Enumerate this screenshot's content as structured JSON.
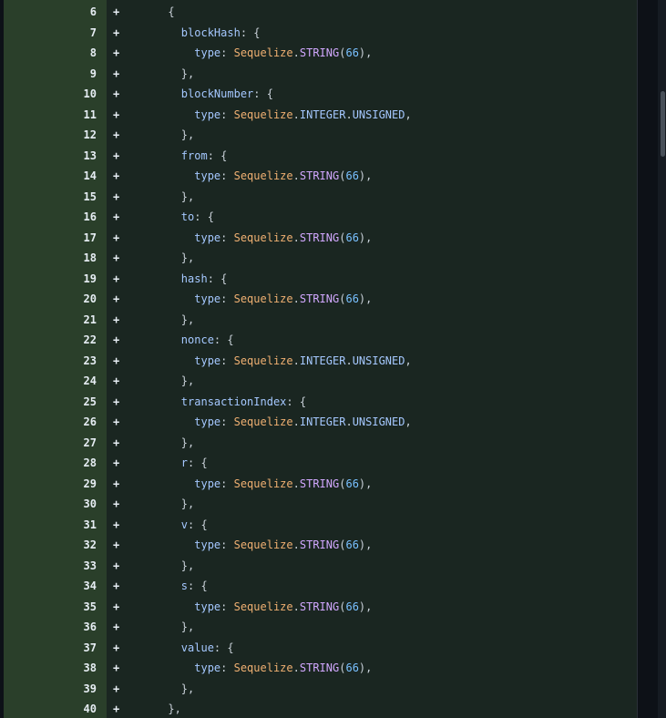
{
  "lines": [
    {
      "n": "6",
      "m": "+",
      "tokens": [
        {
          "t": "      {",
          "c": "punc"
        }
      ]
    },
    {
      "n": "7",
      "m": "+",
      "tokens": [
        {
          "t": "        blockHash",
          "c": "key"
        },
        {
          "t": ": {",
          "c": "punc"
        }
      ]
    },
    {
      "n": "8",
      "m": "+",
      "tokens": [
        {
          "t": "          type",
          "c": "key"
        },
        {
          "t": ": ",
          "c": "punc"
        },
        {
          "t": "Sequelize",
          "c": "class"
        },
        {
          "t": ".",
          "c": "punc"
        },
        {
          "t": "STRING",
          "c": "method"
        },
        {
          "t": "(",
          "c": "punc"
        },
        {
          "t": "66",
          "c": "num"
        },
        {
          "t": "),",
          "c": "punc"
        }
      ]
    },
    {
      "n": "9",
      "m": "+",
      "tokens": [
        {
          "t": "        },",
          "c": "punc"
        }
      ]
    },
    {
      "n": "10",
      "m": "+",
      "tokens": [
        {
          "t": "        blockNumber",
          "c": "key"
        },
        {
          "t": ": {",
          "c": "punc"
        }
      ]
    },
    {
      "n": "11",
      "m": "+",
      "tokens": [
        {
          "t": "          type",
          "c": "key"
        },
        {
          "t": ": ",
          "c": "punc"
        },
        {
          "t": "Sequelize",
          "c": "class"
        },
        {
          "t": ".",
          "c": "punc"
        },
        {
          "t": "INTEGER",
          "c": "prop"
        },
        {
          "t": ".",
          "c": "punc"
        },
        {
          "t": "UNSIGNED",
          "c": "prop"
        },
        {
          "t": ",",
          "c": "punc"
        }
      ]
    },
    {
      "n": "12",
      "m": "+",
      "tokens": [
        {
          "t": "        },",
          "c": "punc"
        }
      ]
    },
    {
      "n": "13",
      "m": "+",
      "tokens": [
        {
          "t": "        from",
          "c": "key"
        },
        {
          "t": ": {",
          "c": "punc"
        }
      ]
    },
    {
      "n": "14",
      "m": "+",
      "tokens": [
        {
          "t": "          type",
          "c": "key"
        },
        {
          "t": ": ",
          "c": "punc"
        },
        {
          "t": "Sequelize",
          "c": "class"
        },
        {
          "t": ".",
          "c": "punc"
        },
        {
          "t": "STRING",
          "c": "method"
        },
        {
          "t": "(",
          "c": "punc"
        },
        {
          "t": "66",
          "c": "num"
        },
        {
          "t": "),",
          "c": "punc"
        }
      ]
    },
    {
      "n": "15",
      "m": "+",
      "tokens": [
        {
          "t": "        },",
          "c": "punc"
        }
      ]
    },
    {
      "n": "16",
      "m": "+",
      "tokens": [
        {
          "t": "        to",
          "c": "key"
        },
        {
          "t": ": {",
          "c": "punc"
        }
      ]
    },
    {
      "n": "17",
      "m": "+",
      "tokens": [
        {
          "t": "          type",
          "c": "key"
        },
        {
          "t": ": ",
          "c": "punc"
        },
        {
          "t": "Sequelize",
          "c": "class"
        },
        {
          "t": ".",
          "c": "punc"
        },
        {
          "t": "STRING",
          "c": "method"
        },
        {
          "t": "(",
          "c": "punc"
        },
        {
          "t": "66",
          "c": "num"
        },
        {
          "t": "),",
          "c": "punc"
        }
      ]
    },
    {
      "n": "18",
      "m": "+",
      "tokens": [
        {
          "t": "        },",
          "c": "punc"
        }
      ]
    },
    {
      "n": "19",
      "m": "+",
      "tokens": [
        {
          "t": "        hash",
          "c": "key"
        },
        {
          "t": ": {",
          "c": "punc"
        }
      ]
    },
    {
      "n": "20",
      "m": "+",
      "tokens": [
        {
          "t": "          type",
          "c": "key"
        },
        {
          "t": ": ",
          "c": "punc"
        },
        {
          "t": "Sequelize",
          "c": "class"
        },
        {
          "t": ".",
          "c": "punc"
        },
        {
          "t": "STRING",
          "c": "method"
        },
        {
          "t": "(",
          "c": "punc"
        },
        {
          "t": "66",
          "c": "num"
        },
        {
          "t": "),",
          "c": "punc"
        }
      ]
    },
    {
      "n": "21",
      "m": "+",
      "tokens": [
        {
          "t": "        },",
          "c": "punc"
        }
      ]
    },
    {
      "n": "22",
      "m": "+",
      "tokens": [
        {
          "t": "        nonce",
          "c": "key"
        },
        {
          "t": ": {",
          "c": "punc"
        }
      ]
    },
    {
      "n": "23",
      "m": "+",
      "tokens": [
        {
          "t": "          type",
          "c": "key"
        },
        {
          "t": ": ",
          "c": "punc"
        },
        {
          "t": "Sequelize",
          "c": "class"
        },
        {
          "t": ".",
          "c": "punc"
        },
        {
          "t": "INTEGER",
          "c": "prop"
        },
        {
          "t": ".",
          "c": "punc"
        },
        {
          "t": "UNSIGNED",
          "c": "prop"
        },
        {
          "t": ",",
          "c": "punc"
        }
      ]
    },
    {
      "n": "24",
      "m": "+",
      "tokens": [
        {
          "t": "        },",
          "c": "punc"
        }
      ]
    },
    {
      "n": "25",
      "m": "+",
      "tokens": [
        {
          "t": "        transactionIndex",
          "c": "key"
        },
        {
          "t": ": {",
          "c": "punc"
        }
      ]
    },
    {
      "n": "26",
      "m": "+",
      "tokens": [
        {
          "t": "          type",
          "c": "key"
        },
        {
          "t": ": ",
          "c": "punc"
        },
        {
          "t": "Sequelize",
          "c": "class"
        },
        {
          "t": ".",
          "c": "punc"
        },
        {
          "t": "INTEGER",
          "c": "prop"
        },
        {
          "t": ".",
          "c": "punc"
        },
        {
          "t": "UNSIGNED",
          "c": "prop"
        },
        {
          "t": ",",
          "c": "punc"
        }
      ]
    },
    {
      "n": "27",
      "m": "+",
      "tokens": [
        {
          "t": "        },",
          "c": "punc"
        }
      ]
    },
    {
      "n": "28",
      "m": "+",
      "tokens": [
        {
          "t": "        r",
          "c": "key"
        },
        {
          "t": ": {",
          "c": "punc"
        }
      ]
    },
    {
      "n": "29",
      "m": "+",
      "tokens": [
        {
          "t": "          type",
          "c": "key"
        },
        {
          "t": ": ",
          "c": "punc"
        },
        {
          "t": "Sequelize",
          "c": "class"
        },
        {
          "t": ".",
          "c": "punc"
        },
        {
          "t": "STRING",
          "c": "method"
        },
        {
          "t": "(",
          "c": "punc"
        },
        {
          "t": "66",
          "c": "num"
        },
        {
          "t": "),",
          "c": "punc"
        }
      ]
    },
    {
      "n": "30",
      "m": "+",
      "tokens": [
        {
          "t": "        },",
          "c": "punc"
        }
      ]
    },
    {
      "n": "31",
      "m": "+",
      "tokens": [
        {
          "t": "        v",
          "c": "key"
        },
        {
          "t": ": {",
          "c": "punc"
        }
      ]
    },
    {
      "n": "32",
      "m": "+",
      "tokens": [
        {
          "t": "          type",
          "c": "key"
        },
        {
          "t": ": ",
          "c": "punc"
        },
        {
          "t": "Sequelize",
          "c": "class"
        },
        {
          "t": ".",
          "c": "punc"
        },
        {
          "t": "STRING",
          "c": "method"
        },
        {
          "t": "(",
          "c": "punc"
        },
        {
          "t": "66",
          "c": "num"
        },
        {
          "t": "),",
          "c": "punc"
        }
      ]
    },
    {
      "n": "33",
      "m": "+",
      "tokens": [
        {
          "t": "        },",
          "c": "punc"
        }
      ]
    },
    {
      "n": "34",
      "m": "+",
      "tokens": [
        {
          "t": "        s",
          "c": "key"
        },
        {
          "t": ": {",
          "c": "punc"
        }
      ]
    },
    {
      "n": "35",
      "m": "+",
      "tokens": [
        {
          "t": "          type",
          "c": "key"
        },
        {
          "t": ": ",
          "c": "punc"
        },
        {
          "t": "Sequelize",
          "c": "class"
        },
        {
          "t": ".",
          "c": "punc"
        },
        {
          "t": "STRING",
          "c": "method"
        },
        {
          "t": "(",
          "c": "punc"
        },
        {
          "t": "66",
          "c": "num"
        },
        {
          "t": "),",
          "c": "punc"
        }
      ]
    },
    {
      "n": "36",
      "m": "+",
      "tokens": [
        {
          "t": "        },",
          "c": "punc"
        }
      ]
    },
    {
      "n": "37",
      "m": "+",
      "tokens": [
        {
          "t": "        value",
          "c": "key"
        },
        {
          "t": ": {",
          "c": "punc"
        }
      ]
    },
    {
      "n": "38",
      "m": "+",
      "tokens": [
        {
          "t": "          type",
          "c": "key"
        },
        {
          "t": ": ",
          "c": "punc"
        },
        {
          "t": "Sequelize",
          "c": "class"
        },
        {
          "t": ".",
          "c": "punc"
        },
        {
          "t": "STRING",
          "c": "method"
        },
        {
          "t": "(",
          "c": "punc"
        },
        {
          "t": "66",
          "c": "num"
        },
        {
          "t": "),",
          "c": "punc"
        }
      ]
    },
    {
      "n": "39",
      "m": "+",
      "tokens": [
        {
          "t": "        },",
          "c": "punc"
        }
      ]
    },
    {
      "n": "40",
      "m": "+",
      "tokens": [
        {
          "t": "      },",
          "c": "punc"
        }
      ]
    }
  ]
}
